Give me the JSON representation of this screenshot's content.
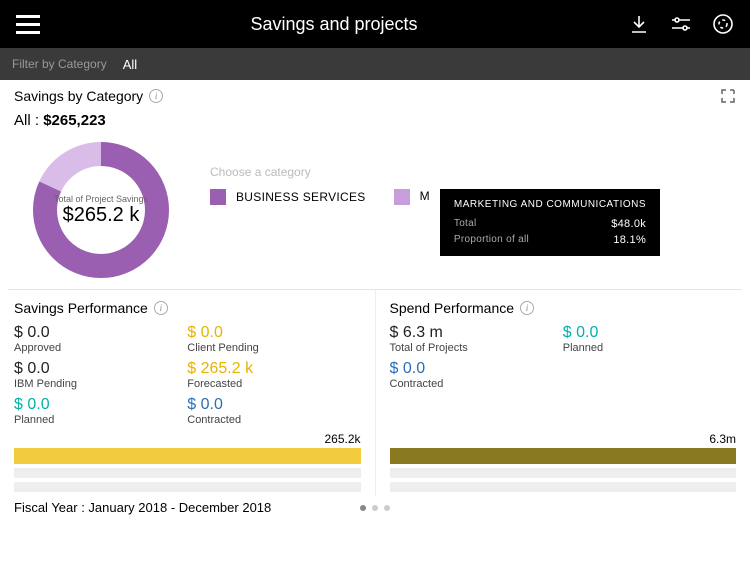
{
  "header": {
    "title": "Savings and projects"
  },
  "filter": {
    "label": "Filter by Category",
    "value": "All"
  },
  "savings_panel": {
    "title": "Savings by Category",
    "summary_label": "All :",
    "summary_value": "$265,223",
    "center_label": "Total of Project Savings",
    "center_value": "$265.2 k",
    "choose_label": "Choose a category",
    "legend": [
      {
        "label": "BUSINESS SERVICES",
        "color": "#9a5fb0"
      },
      {
        "label": "M",
        "color": "#c79edb"
      }
    ],
    "tooltip": {
      "title": "MARKETING AND COMMUNICATIONS",
      "total_label": "Total",
      "total_value": "$48.0k",
      "prop_label": "Proportion of all",
      "prop_value": "18.1%"
    }
  },
  "chart_data": {
    "type": "pie",
    "title": "Savings by Category",
    "total_label": "Total of Project Savings",
    "total_value": 265.2,
    "unit": "k",
    "series": [
      {
        "name": "BUSINESS SERVICES",
        "value": 217.2,
        "percent": 81.9,
        "color": "#9a5fb0"
      },
      {
        "name": "MARKETING AND COMMUNICATIONS",
        "value": 48.0,
        "percent": 18.1,
        "color": "#c79edb"
      }
    ]
  },
  "savings_perf": {
    "title": "Savings Performance",
    "metrics": [
      {
        "value": "$ 0.0",
        "label": "Approved",
        "colorClass": "c-black"
      },
      {
        "value": "$ 0.0",
        "label": "Client Pending",
        "colorClass": "c-yellow"
      },
      {
        "value": "$ 0.0",
        "label": "IBM Pending",
        "colorClass": "c-black"
      },
      {
        "value": "$ 265.2 k",
        "label": "Forecasted",
        "colorClass": "c-yellow"
      },
      {
        "value": "$ 0.0",
        "label": "Planned",
        "colorClass": "c-cyan"
      },
      {
        "value": "$ 0.0",
        "label": "Contracted",
        "colorClass": "c-blue"
      }
    ],
    "bar_label": "265.2k",
    "bar_color": "#f2cb3f"
  },
  "spend_perf": {
    "title": "Spend Performance",
    "metrics": [
      {
        "value": "$ 6.3 m",
        "label": "Total of Projects",
        "colorClass": "c-black"
      },
      {
        "value": "$ 0.0",
        "label": "Planned",
        "colorClass": "c-cyan"
      },
      {
        "value": "$ 0.0",
        "label": "Contracted",
        "colorClass": "c-blue"
      }
    ],
    "bar_label": "6.3m",
    "bar_color": "#8a7a1f"
  },
  "footer": {
    "fiscal_label": "Fiscal Year : January 2018 - December 2018"
  }
}
